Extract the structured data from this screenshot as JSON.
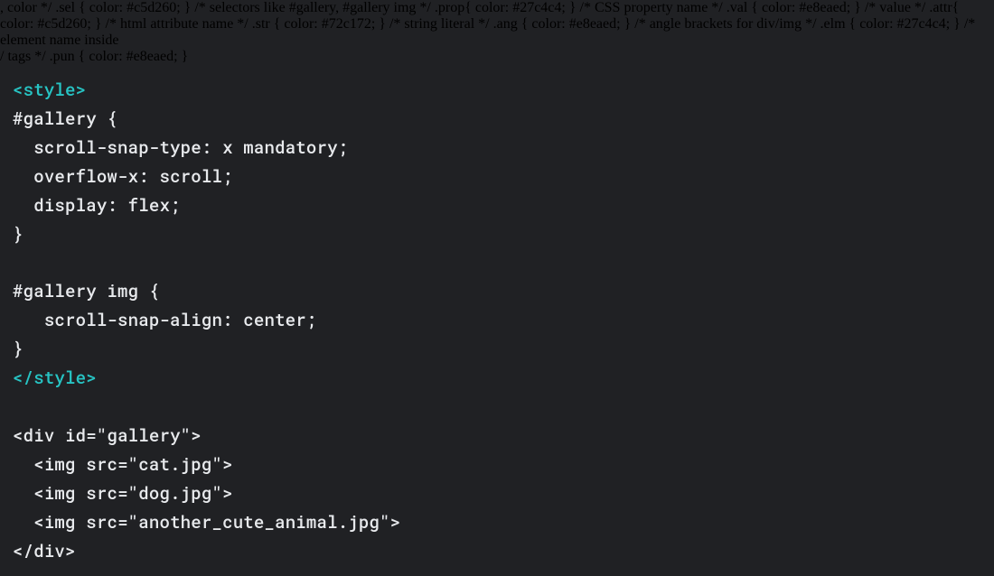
{
  "code_block": {
    "language": "html-css",
    "lines": [
      {
        "tokens": [
          {
            "t": "<style>",
            "c": "tag"
          }
        ]
      },
      {
        "tokens": [
          {
            "t": "#gallery",
            "c": "sel"
          },
          {
            "t": " {",
            "c": "pun"
          }
        ]
      },
      {
        "tokens": [
          {
            "t": "  ",
            "c": "pun"
          },
          {
            "t": "scroll-snap-type",
            "c": "prop"
          },
          {
            "t": ": ",
            "c": "pun"
          },
          {
            "t": "x mandatory",
            "c": "val"
          },
          {
            "t": ";",
            "c": "pun"
          }
        ]
      },
      {
        "tokens": [
          {
            "t": "  ",
            "c": "pun"
          },
          {
            "t": "overflow-x",
            "c": "prop"
          },
          {
            "t": ": ",
            "c": "pun"
          },
          {
            "t": "scroll",
            "c": "val"
          },
          {
            "t": ";",
            "c": "pun"
          }
        ]
      },
      {
        "tokens": [
          {
            "t": "  ",
            "c": "pun"
          },
          {
            "t": "display",
            "c": "prop"
          },
          {
            "t": ": ",
            "c": "pun"
          },
          {
            "t": "flex",
            "c": "val"
          },
          {
            "t": ";",
            "c": "pun"
          }
        ]
      },
      {
        "tokens": [
          {
            "t": "}",
            "c": "pun"
          }
        ]
      },
      {
        "tokens": [
          {
            "t": "",
            "c": "pun"
          }
        ]
      },
      {
        "tokens": [
          {
            "t": "#gallery img",
            "c": "sel"
          },
          {
            "t": " {",
            "c": "pun"
          }
        ]
      },
      {
        "tokens": [
          {
            "t": "   ",
            "c": "pun"
          },
          {
            "t": "scroll-snap-align",
            "c": "prop"
          },
          {
            "t": ": ",
            "c": "pun"
          },
          {
            "t": "center",
            "c": "val"
          },
          {
            "t": ";",
            "c": "pun"
          }
        ]
      },
      {
        "tokens": [
          {
            "t": "}",
            "c": "pun"
          }
        ]
      },
      {
        "tokens": [
          {
            "t": "</style>",
            "c": "tag"
          }
        ]
      },
      {
        "tokens": [
          {
            "t": "",
            "c": "pun"
          }
        ]
      },
      {
        "tokens": [
          {
            "t": "<",
            "c": "ang"
          },
          {
            "t": "div",
            "c": "elm"
          },
          {
            "t": " ",
            "c": "pun"
          },
          {
            "t": "id",
            "c": "attr"
          },
          {
            "t": "=",
            "c": "pun"
          },
          {
            "t": "\"gallery\"",
            "c": "str"
          },
          {
            "t": ">",
            "c": "ang"
          }
        ]
      },
      {
        "tokens": [
          {
            "t": "  ",
            "c": "pun"
          },
          {
            "t": "<",
            "c": "ang"
          },
          {
            "t": "img",
            "c": "elm"
          },
          {
            "t": " ",
            "c": "pun"
          },
          {
            "t": "src",
            "c": "attr"
          },
          {
            "t": "=",
            "c": "pun"
          },
          {
            "t": "\"cat.jpg\"",
            "c": "str"
          },
          {
            "t": ">",
            "c": "ang"
          }
        ]
      },
      {
        "tokens": [
          {
            "t": "  ",
            "c": "pun"
          },
          {
            "t": "<",
            "c": "ang"
          },
          {
            "t": "img",
            "c": "elm"
          },
          {
            "t": " ",
            "c": "pun"
          },
          {
            "t": "src",
            "c": "attr"
          },
          {
            "t": "=",
            "c": "pun"
          },
          {
            "t": "\"dog.jpg\"",
            "c": "str"
          },
          {
            "t": ">",
            "c": "ang"
          }
        ]
      },
      {
        "tokens": [
          {
            "t": "  ",
            "c": "pun"
          },
          {
            "t": "<",
            "c": "ang"
          },
          {
            "t": "img",
            "c": "elm"
          },
          {
            "t": " ",
            "c": "pun"
          },
          {
            "t": "src",
            "c": "attr"
          },
          {
            "t": "=",
            "c": "pun"
          },
          {
            "t": "\"another_cute_animal.jpg\"",
            "c": "str"
          },
          {
            "t": ">",
            "c": "ang"
          }
        ]
      },
      {
        "tokens": [
          {
            "t": "</",
            "c": "ang"
          },
          {
            "t": "div",
            "c": "elm"
          },
          {
            "t": ">",
            "c": "ang"
          }
        ]
      }
    ]
  }
}
